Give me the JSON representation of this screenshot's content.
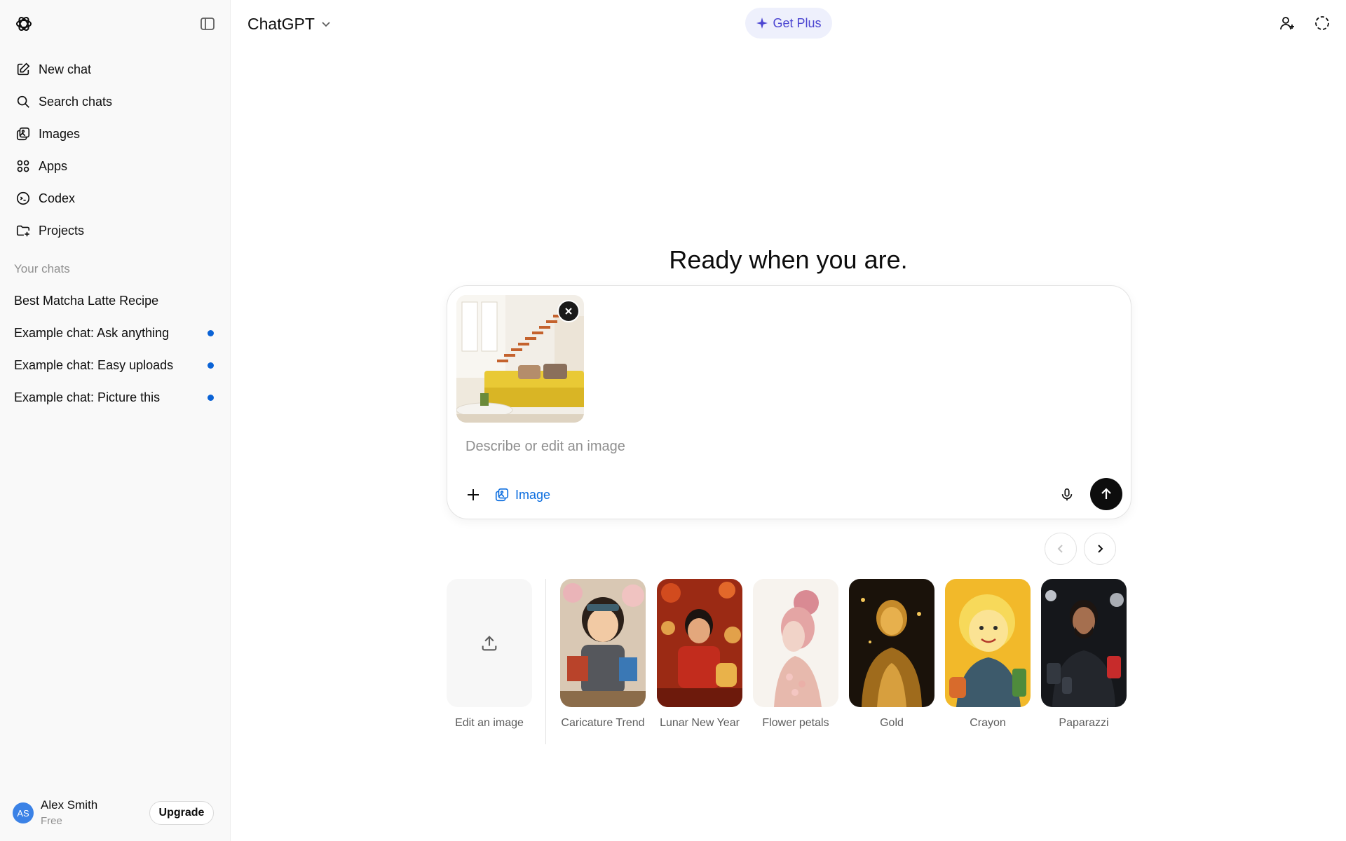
{
  "sidebar": {
    "items": [
      {
        "label": "New chat",
        "icon": "new-chat-icon"
      },
      {
        "label": "Search chats",
        "icon": "search-icon"
      },
      {
        "label": "Images",
        "icon": "images-icon"
      },
      {
        "label": "Apps",
        "icon": "apps-icon"
      },
      {
        "label": "Codex",
        "icon": "codex-icon"
      },
      {
        "label": "Projects",
        "icon": "projects-icon"
      }
    ],
    "section_label": "Your chats",
    "chats": [
      {
        "title": "Best Matcha Latte Recipe",
        "unread": false
      },
      {
        "title": "Example chat: Ask anything",
        "unread": true
      },
      {
        "title": "Example chat: Easy uploads",
        "unread": true
      },
      {
        "title": "Example chat: Picture this",
        "unread": true
      }
    ],
    "user": {
      "initials": "AS",
      "name": "Alex Smith",
      "plan": "Free",
      "upgrade_label": "Upgrade"
    }
  },
  "header": {
    "model": "ChatGPT",
    "get_plus": "Get Plus"
  },
  "main": {
    "headline": "Ready when you are.",
    "composer": {
      "placeholder": "Describe or edit an image",
      "value": "",
      "tool_label": "Image"
    },
    "styles": [
      {
        "label": "Edit an image"
      },
      {
        "label": "Caricature Trend"
      },
      {
        "label": "Lunar New Year"
      },
      {
        "label": "Flower petals"
      },
      {
        "label": "Gold"
      },
      {
        "label": "Crayon"
      },
      {
        "label": "Paparazzi"
      }
    ]
  },
  "colors": {
    "accent": "#4b45d1",
    "link": "#0b6ddf",
    "unread_dot": "#0b63d6",
    "sidebar_bg": "#f9f9f9"
  }
}
